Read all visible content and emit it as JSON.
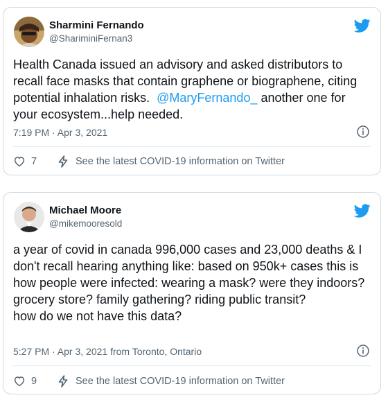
{
  "tweets": [
    {
      "author_name": "Sharmini Fernando",
      "handle": "@ShariminiFernan3",
      "text_before": "Health Canada issued an advisory and asked distributors to recall face masks that contain graphene or biographene, citing potential inhalation risks.  ",
      "mention": "@MaryFernando_",
      "text_after": " another one for your ecosystem...help needed.",
      "timestamp": "7:19 PM · Apr 3, 2021",
      "likes": "7",
      "covid_link": "See the latest COVID-19 information on Twitter"
    },
    {
      "author_name": "Michael Moore",
      "handle": "@mikemooresold",
      "text": "a year of covid in canada 996,000 cases and 23,000 deaths & I don't recall hearing anything like: based on 950k+ cases this is how people were infected: wearing a mask? were they indoors? grocery store? family gathering? riding public transit?\nhow do we not have this data?",
      "timestamp": "5:27 PM · Apr 3, 2021 from Toronto, Ontario",
      "likes": "9",
      "covid_link": "See the latest COVID-19 information on Twitter"
    }
  ],
  "icons": {
    "brand": "twitter-bird-icon",
    "info": "info-icon",
    "like": "heart-icon",
    "covid": "lightning-icon"
  },
  "colors": {
    "twitter_blue": "#1d9bf0",
    "secondary_text": "#536471",
    "border": "#cfd9de"
  }
}
